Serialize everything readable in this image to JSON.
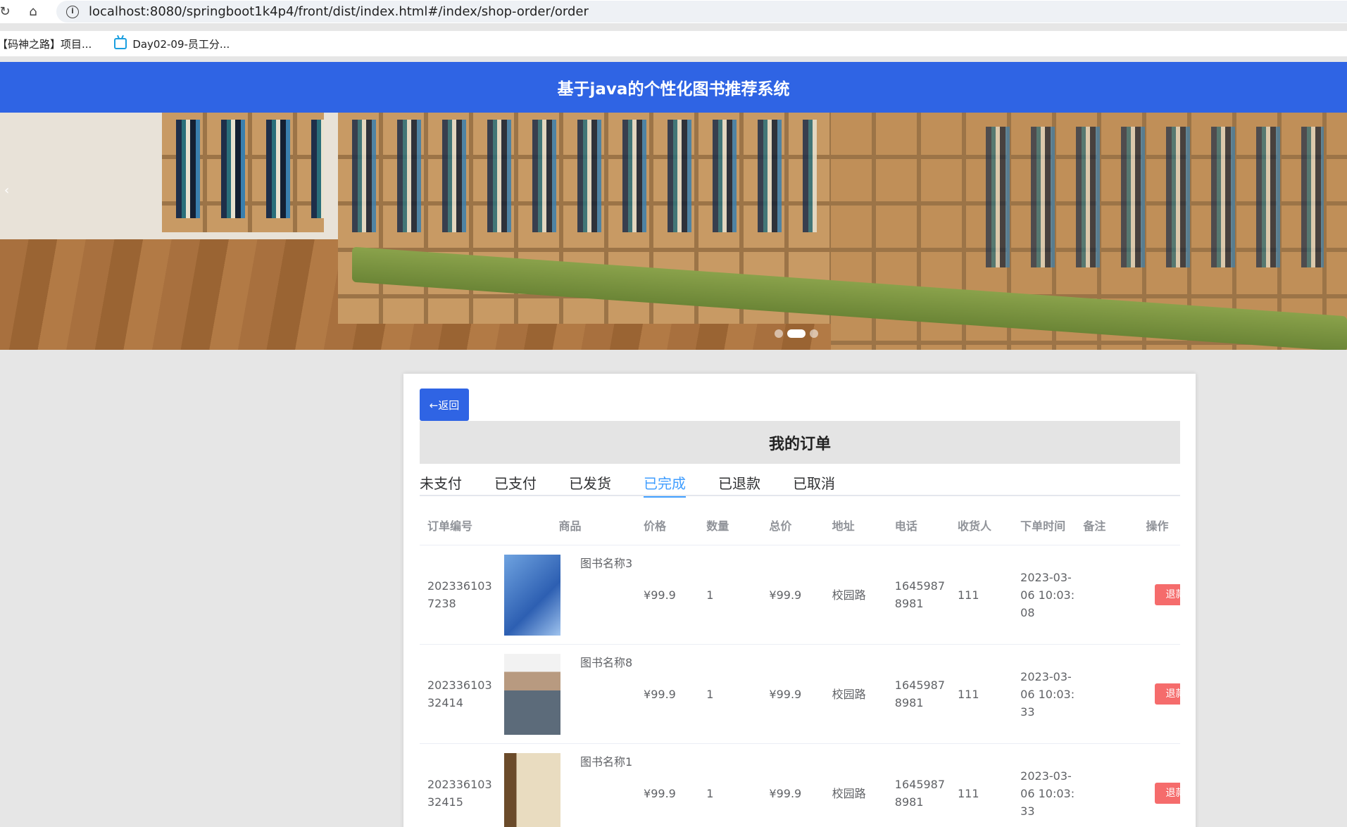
{
  "browser": {
    "url": "localhost:8080/springboot1k4p4/front/dist/index.html#/index/shop-order/order",
    "bookmarks": [
      {
        "label": "【码神之路】项目..."
      },
      {
        "label": "Day02-09-员工分..."
      }
    ]
  },
  "header": {
    "title": "基于java的个性化图书推荐系统"
  },
  "banner": {
    "prev_glyph": "‹"
  },
  "page": {
    "back_label": "←返回",
    "title": "我的订单",
    "tabs": [
      {
        "label": "未支付"
      },
      {
        "label": "已支付"
      },
      {
        "label": "已发货"
      },
      {
        "label": "已完成"
      },
      {
        "label": "已退款"
      },
      {
        "label": "已取消"
      }
    ],
    "active_tab": "已完成"
  },
  "table": {
    "columns": [
      "订单编号",
      "商品",
      "价格",
      "数量",
      "总价",
      "地址",
      "电话",
      "收货人",
      "下单时间",
      "备注",
      "操作"
    ],
    "rows": [
      {
        "order_no": "2023361037238",
        "goods": "图书名称3",
        "price": "¥99.9",
        "qty": "1",
        "total": "¥99.9",
        "address": "校园路",
        "phone": "16459878981",
        "receiver": "111",
        "time": "2023-03-06 10:03:08",
        "note": "",
        "action": "退款"
      },
      {
        "order_no": "20233610332414",
        "goods": "图书名称8",
        "price": "¥99.9",
        "qty": "1",
        "total": "¥99.9",
        "address": "校园路",
        "phone": "16459878981",
        "receiver": "111",
        "time": "2023-03-06 10:03:33",
        "note": "",
        "action": "退款"
      },
      {
        "order_no": "20233610332415",
        "goods": "图书名称1",
        "price": "¥99.9",
        "qty": "1",
        "total": "¥99.9",
        "address": "校园路",
        "phone": "16459878981",
        "receiver": "111",
        "time": "2023-03-06 10:03:33",
        "note": "",
        "action": "退款"
      }
    ]
  },
  "colors": {
    "header_bg": "#2f64e4",
    "tab_active": "#409eff",
    "refund_bg": "#f56c6c"
  }
}
